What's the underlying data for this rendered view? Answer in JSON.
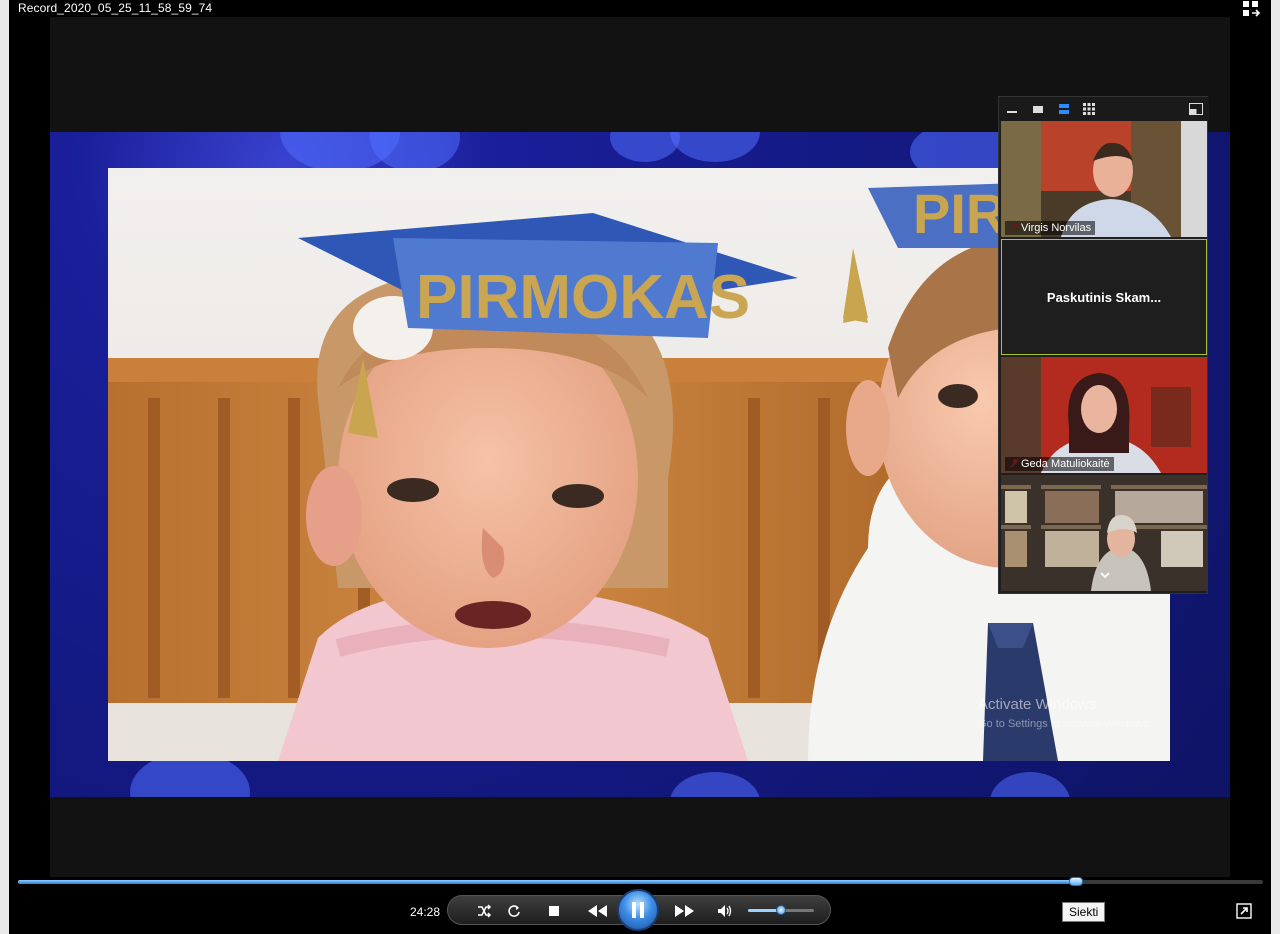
{
  "window": {
    "title": "Record_2020_05_25_11_58_59_74"
  },
  "video": {
    "watermark_line1": "Activate Windows",
    "watermark_line2": "Go to Settings to activate Windows."
  },
  "gallery": {
    "tiles": [
      {
        "name": "Virgis Norvilas",
        "muted": true
      },
      {
        "name": "Paskutinis  Skam...",
        "muted": false,
        "active_speaker": true
      },
      {
        "name": "Geda Matuliokaitė",
        "muted": true
      },
      {
        "name": "",
        "muted": false
      }
    ],
    "more_icon": "chevron-down-icon"
  },
  "playback": {
    "time": "24:28",
    "progress": 0.85,
    "volume": 0.5,
    "state": "playing"
  },
  "tooltip": {
    "text": "Siekti"
  },
  "colors": {
    "accent": "#2a7cd8",
    "slide_bg": "#141a86",
    "active_border": "#a8c23a"
  }
}
